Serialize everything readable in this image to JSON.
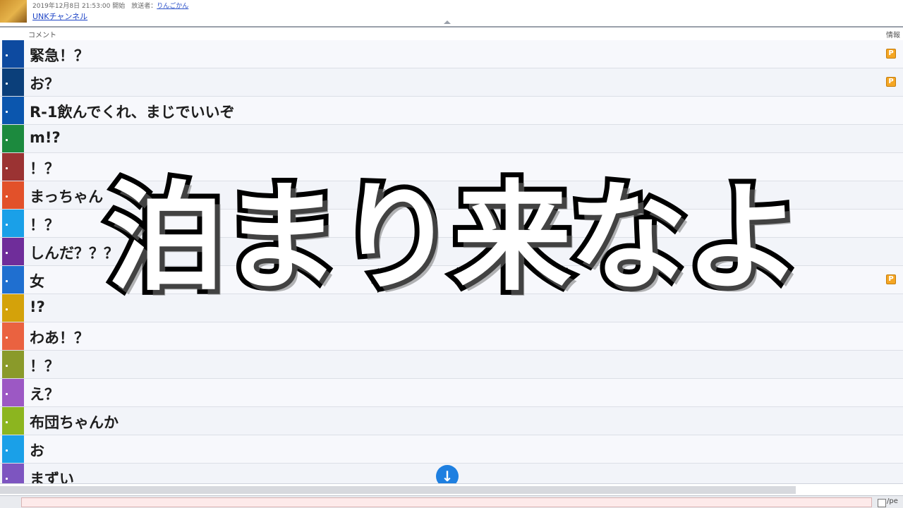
{
  "header": {
    "meta": "2019年12月8日 21:53:00 開始　放送者：",
    "broadcaster": "りんごかん",
    "channel": "UNKチャンネル"
  },
  "columns": {
    "comment": "コメント",
    "info": "情報"
  },
  "comments": [
    {
      "text": "緊急！？",
      "color": "#0d4aa0",
      "badge": "P"
    },
    {
      "text": "お？",
      "color": "#0b3f7a",
      "badge": "P"
    },
    {
      "text": "R-1飲んでくれ、まじでいいぞ",
      "color": "#0b56ae",
      "badge": ""
    },
    {
      "text": "m!?",
      "color": "#1c8a3e",
      "badge": ""
    },
    {
      "text": "！？",
      "color": "#9b3333",
      "badge": ""
    },
    {
      "text": "まっちゃん",
      "color": "#e2512a",
      "badge": ""
    },
    {
      "text": "！？",
      "color": "#1aa0e8",
      "badge": ""
    },
    {
      "text": "しんだ？？？",
      "color": "#6f2d9a",
      "badge": ""
    },
    {
      "text": "女",
      "color": "#1f6fd0",
      "badge": "P"
    },
    {
      "text": "!?",
      "color": "#d4a20a",
      "badge": ""
    },
    {
      "text": "わあ！？",
      "color": "#ea6240",
      "badge": ""
    },
    {
      "text": "！？",
      "color": "#8a9a2a",
      "badge": ""
    },
    {
      "text": "え？",
      "color": "#9c58c4",
      "badge": ""
    },
    {
      "text": "布団ちゃんか",
      "color": "#8cb51f",
      "badge": ""
    },
    {
      "text": "お",
      "color": "#1aa0e8",
      "badge": ""
    },
    {
      "text": "まずい",
      "color": "#7d55c0",
      "badge": ""
    }
  ],
  "overlay_caption": "泊まり来なよ",
  "scroll_button_icon": "arrow-down-icon",
  "input": {
    "command": "/pe"
  }
}
